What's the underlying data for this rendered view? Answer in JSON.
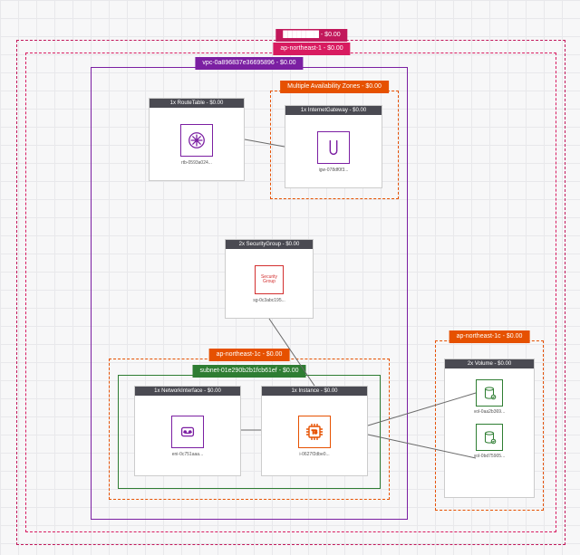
{
  "account": {
    "label": "████████ - $0.00"
  },
  "region": {
    "label": "ap-northeast-1 - $0.00"
  },
  "vpc": {
    "label": "vpc-0a896837e36695896 - $0.00"
  },
  "maz": {
    "label": "Multiple Availability Zones - $0.00"
  },
  "az_subnet": {
    "label": "ap-northeast-1c - $0.00"
  },
  "subnet": {
    "label": "subnet-01e290b2b1fcb61ef - $0.00"
  },
  "az_vol": {
    "label": "ap-northeast-1c - $0.00"
  },
  "resources": {
    "route_table": {
      "title": "1x RouteTable - $0.00",
      "id": "rtb-0593a024..."
    },
    "igw": {
      "title": "1x InternetGateway - $0.00",
      "id": "igw-078df0f3..."
    },
    "sg": {
      "title": "2x SecurityGroup - $0.00",
      "id": "sg-0c3abc195..."
    },
    "eni": {
      "title": "1x NetworkInterface - $0.00",
      "id": "eni-0c751aaa..."
    },
    "instance": {
      "title": "1x Instance - $0.00",
      "id": "i-0627f2dbe0..."
    },
    "volumes": {
      "title": "2x Volume - $0.00",
      "id1": "vol-0aa2b369...",
      "id2": "vol-0bd75905..."
    }
  },
  "chart_data": {
    "type": "diagram",
    "title": "AWS Resource Topology",
    "nodes": [
      {
        "id": "account",
        "type": "Account",
        "label": "████████",
        "cost": "$0.00"
      },
      {
        "id": "region",
        "type": "Region",
        "label": "ap-northeast-1",
        "cost": "$0.00",
        "parent": "account"
      },
      {
        "id": "vpc",
        "type": "VPC",
        "label": "vpc-0a896837e36695896",
        "cost": "$0.00",
        "parent": "region"
      },
      {
        "id": "maz",
        "type": "AvailabilityZoneGroup",
        "label": "Multiple Availability Zones",
        "cost": "$0.00",
        "parent": "vpc"
      },
      {
        "id": "rtb",
        "type": "RouteTable",
        "count": 1,
        "label": "rtb-0593a024...",
        "cost": "$0.00",
        "parent": "vpc"
      },
      {
        "id": "igw",
        "type": "InternetGateway",
        "count": 1,
        "label": "igw-078df0f3...",
        "cost": "$0.00",
        "parent": "maz"
      },
      {
        "id": "sg",
        "type": "SecurityGroup",
        "count": 2,
        "label": "sg-0c3abc195...",
        "cost": "$0.00",
        "parent": "vpc"
      },
      {
        "id": "az1",
        "type": "AvailabilityZone",
        "label": "ap-northeast-1c",
        "cost": "$0.00",
        "parent": "vpc"
      },
      {
        "id": "subnet",
        "type": "Subnet",
        "label": "subnet-01e290b2b1fcb61ef",
        "cost": "$0.00",
        "parent": "az1"
      },
      {
        "id": "eni",
        "type": "NetworkInterface",
        "count": 1,
        "label": "eni-0c751aaa...",
        "cost": "$0.00",
        "parent": "subnet"
      },
      {
        "id": "ec2",
        "type": "Instance",
        "count": 1,
        "label": "i-0627f2dbe0...",
        "cost": "$0.00",
        "parent": "subnet"
      },
      {
        "id": "az2",
        "type": "AvailabilityZone",
        "label": "ap-northeast-1c",
        "cost": "$0.00",
        "parent": "region"
      },
      {
        "id": "vol1",
        "type": "Volume",
        "label": "vol-0aa2b369...",
        "cost": "$0.00",
        "parent": "az2"
      },
      {
        "id": "vol2",
        "type": "Volume",
        "label": "vol-0bd75905...",
        "cost": "$0.00",
        "parent": "az2"
      }
    ],
    "edges": [
      {
        "from": "rtb",
        "to": "igw"
      },
      {
        "from": "sg",
        "to": "ec2"
      },
      {
        "from": "eni",
        "to": "ec2"
      },
      {
        "from": "ec2",
        "to": "vol1"
      },
      {
        "from": "ec2",
        "to": "vol2"
      }
    ]
  }
}
